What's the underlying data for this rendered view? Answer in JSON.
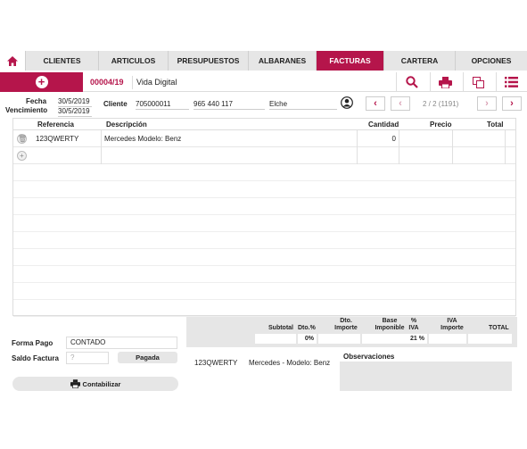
{
  "tabs": [
    {
      "label": "CLIENTES",
      "active": false
    },
    {
      "label": "ARTICULOS",
      "active": false
    },
    {
      "label": "PRESUPUESTOS",
      "active": false
    },
    {
      "label": "ALBARANES",
      "active": false
    },
    {
      "label": "FACTURAS",
      "active": true
    },
    {
      "label": "CARTERA",
      "active": false
    },
    {
      "label": "OPCIONES",
      "active": false
    }
  ],
  "doc": {
    "number": "00004/19",
    "client_name": "Vida Digital",
    "pager": "2 / 2 (1191)"
  },
  "header": {
    "fecha_label": "Fecha",
    "fecha": "30/5/2019",
    "vencimiento_label": "Vencimiento",
    "vencimiento": "30/5/2019",
    "cliente_label": "Cliente",
    "cliente_code": "705000011",
    "phone": "965 440 117",
    "city": "Elche"
  },
  "table": {
    "columns": [
      "Referencia",
      "Descripción",
      "Cantidad",
      "Precio",
      "Total"
    ],
    "rows": [
      {
        "referencia": "123QWERTY",
        "descripcion": "Mercedes Modelo: Benz",
        "cantidad": "0",
        "precio": "",
        "total": ""
      }
    ]
  },
  "totals": {
    "headers": {
      "subtotal": "Subtotal",
      "dto_pct": "Dto.%",
      "dto_importe": "Dto.\nImporte",
      "base": "Base\nImponible",
      "iva_pct": "%\nIVA",
      "iva_importe": "IVA\nImporte",
      "total": "TOTAL"
    },
    "dto_pct_value": "0%",
    "iva_pct_value": "21 %"
  },
  "footer": {
    "forma_pago_label": "Forma Pago",
    "forma_pago": "CONTADO",
    "saldo_label": "Saldo Factura",
    "saldo_placeholder": "?",
    "pagada_label": "Pagada",
    "contabilizar_label": "Contabilizar",
    "summary_ref": "123QWERTY",
    "summary_desc": "Mercedes - Modelo: Benz",
    "observaciones_label": "Observaciones"
  },
  "colors": {
    "accent": "#b5154b",
    "gray": "#e6e6e6"
  }
}
